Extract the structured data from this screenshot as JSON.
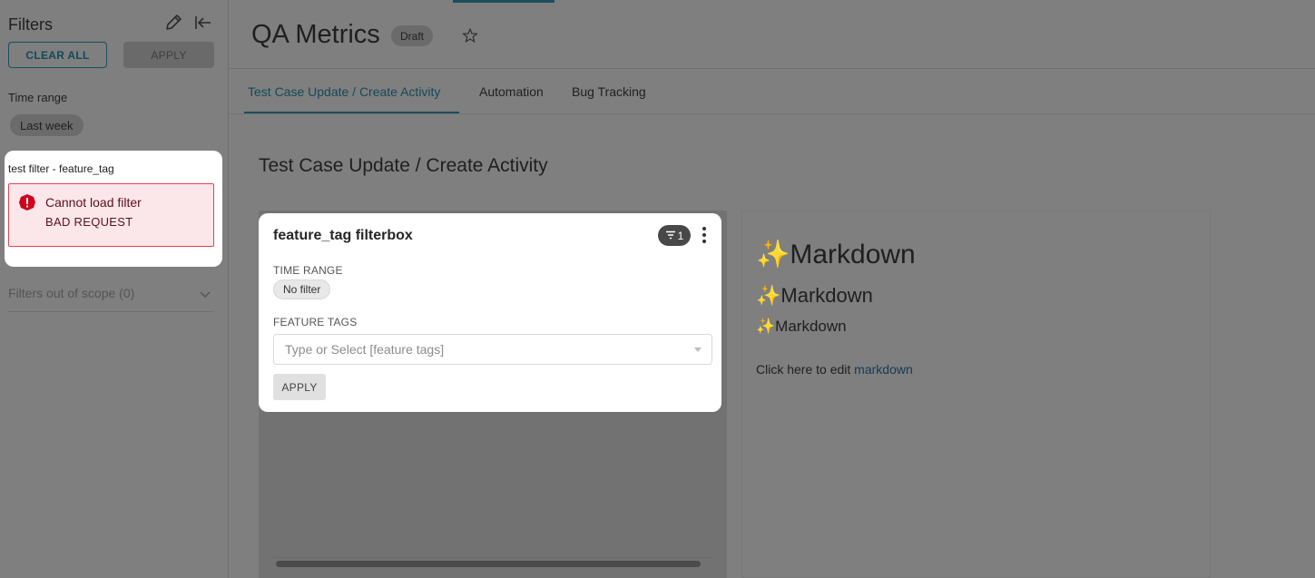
{
  "sidebar": {
    "title": "Filters",
    "clear_all_label": "CLEAR ALL",
    "apply_label": "APPLY",
    "time_range_label": "Time range",
    "time_range_value": "Last week",
    "filter_card": {
      "title": "test filter - feature_tag",
      "error_title": "Cannot load filter",
      "error_detail": "BAD REQUEST"
    },
    "out_of_scope_label": "Filters out of scope (0)"
  },
  "header": {
    "title": "QA Metrics",
    "status_badge": "Draft"
  },
  "tabs": [
    {
      "label": "Test Case Update / Create Activity",
      "active": true
    },
    {
      "label": "Automation",
      "active": false
    },
    {
      "label": "Bug Tracking",
      "active": false
    }
  ],
  "main": {
    "section_title": "Test Case Update / Create Activity",
    "filterbox": {
      "title": "feature_tag filterbox",
      "badge_count": "1",
      "time_range_label": "TIME RANGE",
      "time_range_value": "No filter",
      "feature_tags_label": "FEATURE TAGS",
      "feature_tags_placeholder": "Type or Select [feature tags]",
      "apply_label": "APPLY"
    },
    "markdown": {
      "sparkle": "✨",
      "h1": "Markdown",
      "h2": "Markdown",
      "h3": "Markdown",
      "paragraph_prefix": "Click here to edit ",
      "paragraph_link": "markdown"
    }
  },
  "colors": {
    "accent": "#1b4e5c",
    "error_border": "#e04355",
    "error_bg": "#fbe7ea",
    "overlay": "#7f7f7f"
  }
}
